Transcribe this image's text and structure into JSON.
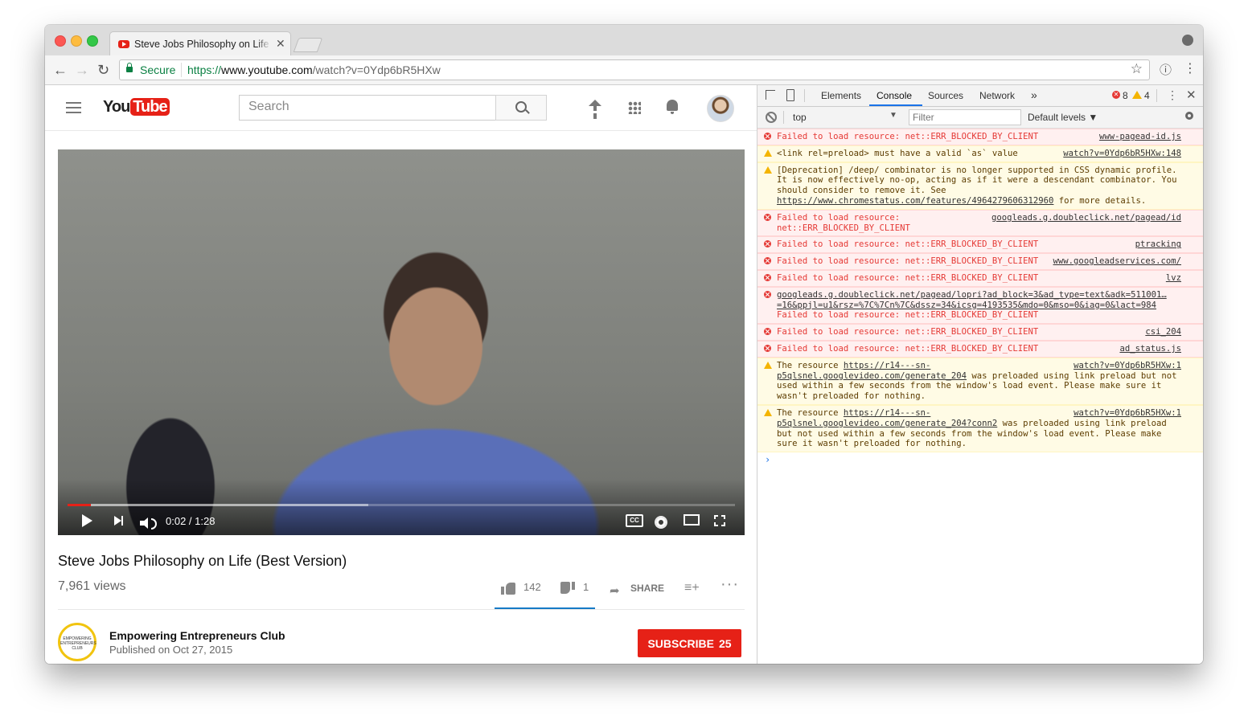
{
  "browser": {
    "tab_title": "Steve Jobs Philosophy on Life",
    "secure_label": "Secure",
    "url_proto": "https://",
    "url_host": "www.youtube.com",
    "url_path": "/watch?v=0Ydp6bR5HXw"
  },
  "youtube": {
    "logo_you": "You",
    "logo_tube": "Tube",
    "search_placeholder": "Search",
    "player": {
      "current_time": "0:02",
      "duration": "1:28",
      "time_label": "0:02 / 1:28",
      "played_fraction": 0.035,
      "buffered_fraction": 0.45,
      "cc_label": "CC"
    },
    "video_title": "Steve Jobs Philosophy on Life (Best Version)",
    "views": "7,961 views",
    "likes": "142",
    "dislikes": "1",
    "share_label": "SHARE",
    "channel_name": "Empowering Entrepreneurs Club",
    "channel_avatar_text": "EMPOWERING ENTREPRENEURS CLUB",
    "published": "Published on Oct 27, 2015",
    "subscribe_label": "SUBSCRIBE",
    "subscriber_count": "25",
    "accent_color": "#e62117"
  },
  "devtools": {
    "tabs": [
      "Elements",
      "Console",
      "Sources",
      "Network"
    ],
    "more_tabs": "»",
    "active_tab": "Console",
    "error_count": "8",
    "warning_count": "4",
    "context": "top",
    "filter_placeholder": "Filter",
    "levels_label": "Default levels ▼",
    "messages": [
      {
        "type": "error",
        "text": "Failed to load resource: net::ERR_BLOCKED_BY_CLIENT",
        "source": "www-pagead-id.js"
      },
      {
        "type": "warning",
        "text": "<link rel=preload> must have a valid `as` value",
        "source": "watch?v=0Ydp6bR5HXw:148"
      },
      {
        "type": "warning",
        "text": "[Deprecation] /deep/ combinator is no longer supported in CSS dynamic profile. It is now effectively no-op, acting as if it were a descendant combinator. You should consider to remove it. See ",
        "link": "https://www.chromestatus.com/features/4964279606312960",
        "text_after": " for more details.",
        "source": ""
      },
      {
        "type": "error",
        "text": "Failed to load resource: net::ERR_BLOCKED_BY_CLIENT",
        "source": "googleads.g.doubleclick.net/pagead/id"
      },
      {
        "type": "error",
        "text": "Failed to load resource: net::ERR_BLOCKED_BY_CLIENT",
        "source": "ptracking"
      },
      {
        "type": "error",
        "text": "Failed to load resource: net::ERR_BLOCKED_BY_CLIENT",
        "source": "www.googleadservices.com/"
      },
      {
        "type": "error",
        "text": "Failed to load resource: net::ERR_BLOCKED_BY_CLIENT",
        "source": "lvz"
      },
      {
        "type": "error",
        "link": "googleads.g.doubleclick.net/pagead/lopri?ad_block=3&ad_type=text&adk=511001…=16&ppjl=u1&rsz=%7C%7Cn%7C&dssz=34&icsg=4193535&mdo=0&mso=0&iag=0&lact=984",
        "text": "Failed to load resource: net::ERR_BLOCKED_BY_CLIENT",
        "source": ""
      },
      {
        "type": "error",
        "text": "Failed to load resource: net::ERR_BLOCKED_BY_CLIENT",
        "source": "csi_204"
      },
      {
        "type": "error",
        "text": "Failed to load resource: net::ERR_BLOCKED_BY_CLIENT",
        "source": "ad_status.js"
      },
      {
        "type": "warning",
        "text": "The resource ",
        "link": "https://r14---sn-p5qlsnel.googlevideo.com/generate_204",
        "text_after": " was preloaded using link preload but not used within a few seconds from the window's load event. Please make sure it wasn't preloaded for nothing.",
        "source": "watch?v=0Ydp6bR5HXw:1"
      },
      {
        "type": "warning",
        "text": "The resource ",
        "link": "https://r14---sn-p5qlsnel.googlevideo.com/generate_204?conn2",
        "text_after": " was preloaded using link preload but not used within a few seconds from the window's load event. Please make sure it wasn't preloaded for nothing.",
        "source": "watch?v=0Ydp6bR5HXw:1"
      }
    ],
    "prompt": "›"
  }
}
